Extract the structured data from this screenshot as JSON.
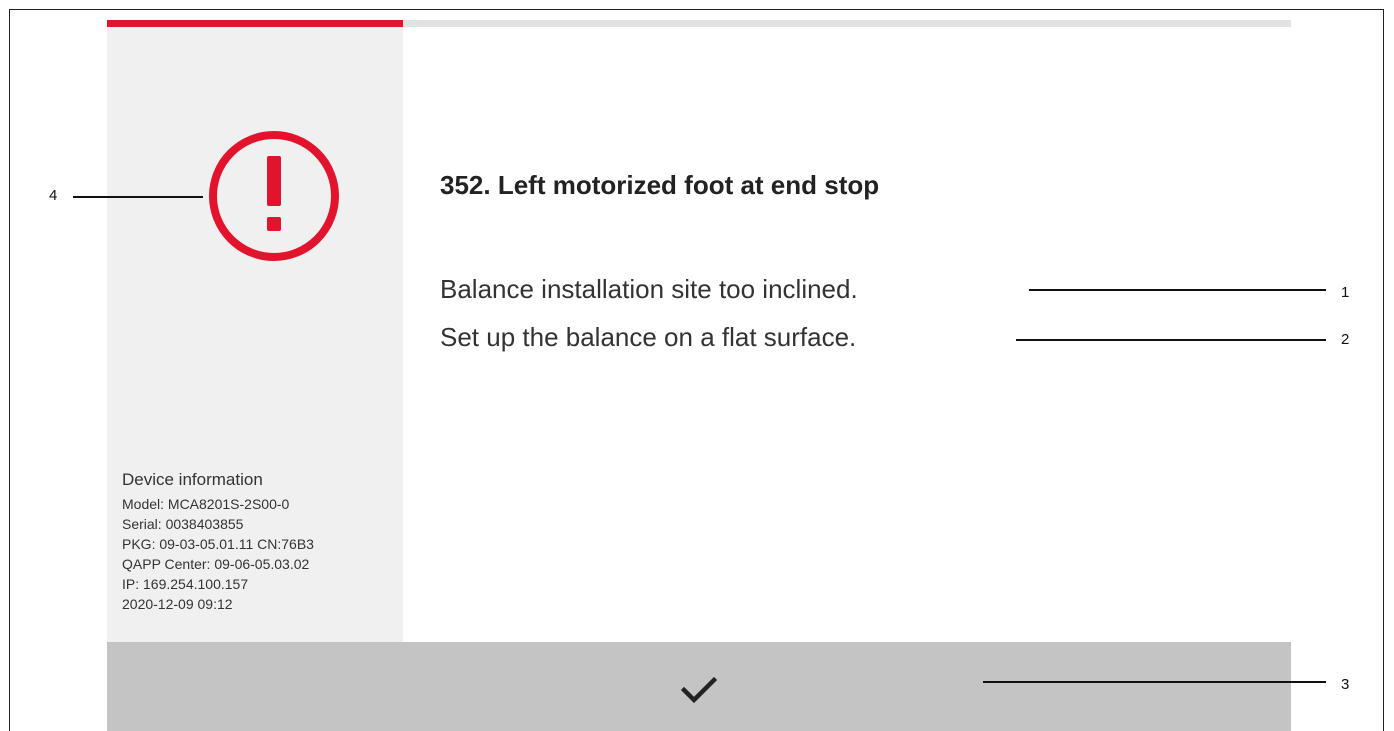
{
  "progress": {
    "value_fraction": 0.25,
    "fill_color": "#e2142d",
    "track_color": "#e3e3e3"
  },
  "sidebar": {
    "icon": "exclamation-circle-icon",
    "icon_color": "#e2142d",
    "device_info": {
      "heading": "Device information",
      "lines": [
        "Model: MCA8201S-2S00-0",
        "Serial: 0038403855",
        "PKG: 09-03-05.01.11 CN:76B3",
        "QAPP Center: 09-06-05.03.02",
        "IP: 169.254.100.157",
        "2020-12-09 09:12"
      ]
    }
  },
  "main": {
    "title": "352. Left motorized foot at end stop",
    "cause": "Balance installation site too inclined.",
    "remedy": "Set up the balance on a flat surface."
  },
  "footer": {
    "confirm_icon": "checkmark-icon"
  },
  "callouts": {
    "c1": "1",
    "c2": "2",
    "c3": "3",
    "c4": "4"
  }
}
